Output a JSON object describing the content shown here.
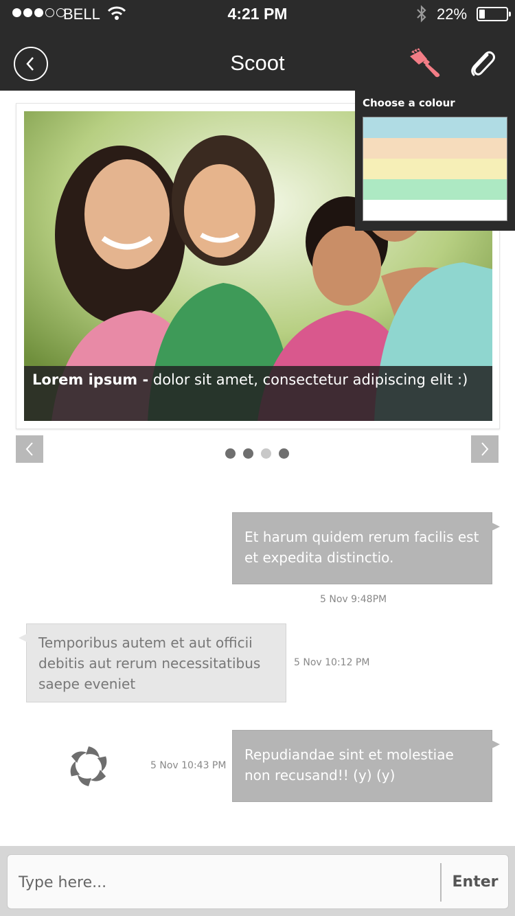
{
  "status_bar": {
    "carrier": "BELL",
    "time": "4:21 PM",
    "battery_percent": "22%",
    "battery_level": 0.22,
    "signal_bars_filled": 3,
    "signal_bars_total": 5
  },
  "nav": {
    "title": "Scoot",
    "back_icon": "chevron-left-circle-icon",
    "brush_icon": "paint-brush-icon",
    "attach_icon": "paperclip-icon",
    "brush_color": "#f37d86"
  },
  "carousel": {
    "caption_bold": "Lorem ipsum -",
    "caption_text": " dolor sit amet, consectetur adipiscing elit :)",
    "dots": [
      true,
      true,
      false,
      true
    ]
  },
  "colour_chooser": {
    "title": "Choose a colour",
    "swatches": [
      "#b0dce4",
      "#f6dcbc",
      "#f6efb7",
      "#ade9c3",
      "#ffffff"
    ]
  },
  "messages": [
    {
      "direction": "out",
      "text": "Et harum quidem rerum facilis est et expedita distinctio.",
      "time": "5 Nov 9:48PM"
    },
    {
      "direction": "in",
      "text": "Temporibus autem et aut officii debitis aut rerum necessitatibus saepe eveniet",
      "time": "5 Nov 10:12 PM"
    },
    {
      "direction": "out",
      "text": "Repudiandae sint et molestiae non recusand!! (y) (y)",
      "time": "5 Nov 10:43 PM"
    }
  ],
  "composer": {
    "placeholder": "Type here...",
    "value": "",
    "enter_label": "Enter"
  }
}
